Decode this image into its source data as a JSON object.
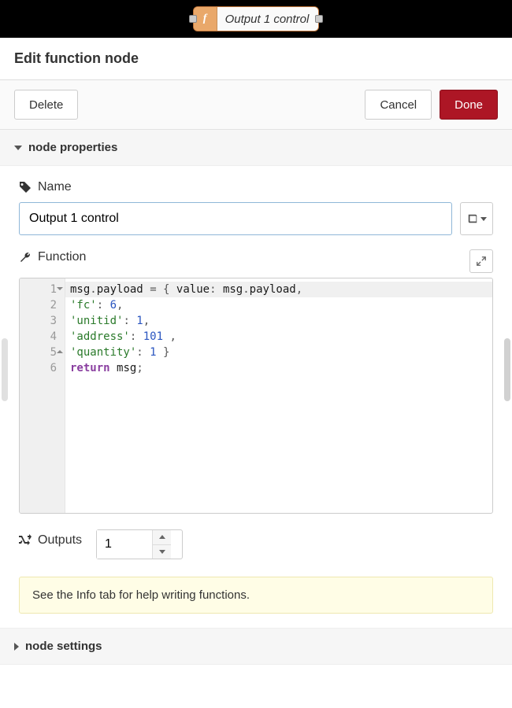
{
  "node": {
    "title": "Output 1 control",
    "icon_name": "function-icon"
  },
  "header": {
    "title": "Edit function node"
  },
  "actions": {
    "delete": "Delete",
    "cancel": "Cancel",
    "done": "Done"
  },
  "sections": {
    "properties": {
      "label": "node properties",
      "expanded": true
    },
    "settings": {
      "label": "node settings",
      "expanded": false
    }
  },
  "fields": {
    "name": {
      "label": "Name",
      "value": "Output 1 control"
    },
    "function": {
      "label": "Function"
    },
    "outputs": {
      "label": "Outputs",
      "value": "1"
    }
  },
  "code": {
    "lines": [
      {
        "n": 1,
        "fold": "down",
        "segments": [
          {
            "t": "msg",
            "c": "ident"
          },
          {
            "t": ".",
            "c": "punc"
          },
          {
            "t": "payload",
            "c": "ident"
          },
          {
            "t": " ",
            "c": "punc"
          },
          {
            "t": "=",
            "c": "punc"
          },
          {
            "t": " { ",
            "c": "punc"
          },
          {
            "t": "value",
            "c": "ident"
          },
          {
            "t": ": ",
            "c": "punc"
          },
          {
            "t": "msg",
            "c": "ident"
          },
          {
            "t": ".",
            "c": "punc"
          },
          {
            "t": "payload",
            "c": "ident"
          },
          {
            "t": ",",
            "c": "punc"
          }
        ],
        "highlight": true
      },
      {
        "n": 2,
        "segments": [
          {
            "t": "'fc'",
            "c": "str"
          },
          {
            "t": ": ",
            "c": "punc"
          },
          {
            "t": "6",
            "c": "num"
          },
          {
            "t": ",",
            "c": "punc"
          }
        ]
      },
      {
        "n": 3,
        "segments": [
          {
            "t": "'unitid'",
            "c": "str"
          },
          {
            "t": ": ",
            "c": "punc"
          },
          {
            "t": "1",
            "c": "num"
          },
          {
            "t": ",",
            "c": "punc"
          }
        ]
      },
      {
        "n": 4,
        "segments": [
          {
            "t": "'address'",
            "c": "str"
          },
          {
            "t": ": ",
            "c": "punc"
          },
          {
            "t": "101",
            "c": "num"
          },
          {
            "t": " ,",
            "c": "punc"
          }
        ]
      },
      {
        "n": 5,
        "fold": "up",
        "segments": [
          {
            "t": "'quantity'",
            "c": "str"
          },
          {
            "t": ": ",
            "c": "punc"
          },
          {
            "t": "1",
            "c": "num"
          },
          {
            "t": " }",
            "c": "punc"
          }
        ]
      },
      {
        "n": 6,
        "segments": [
          {
            "t": "return",
            "c": "kw"
          },
          {
            "t": " ",
            "c": "punc"
          },
          {
            "t": "msg",
            "c": "ident"
          },
          {
            "t": ";",
            "c": "punc"
          }
        ]
      }
    ]
  },
  "info_tip": "See the Info tab for help writing functions."
}
